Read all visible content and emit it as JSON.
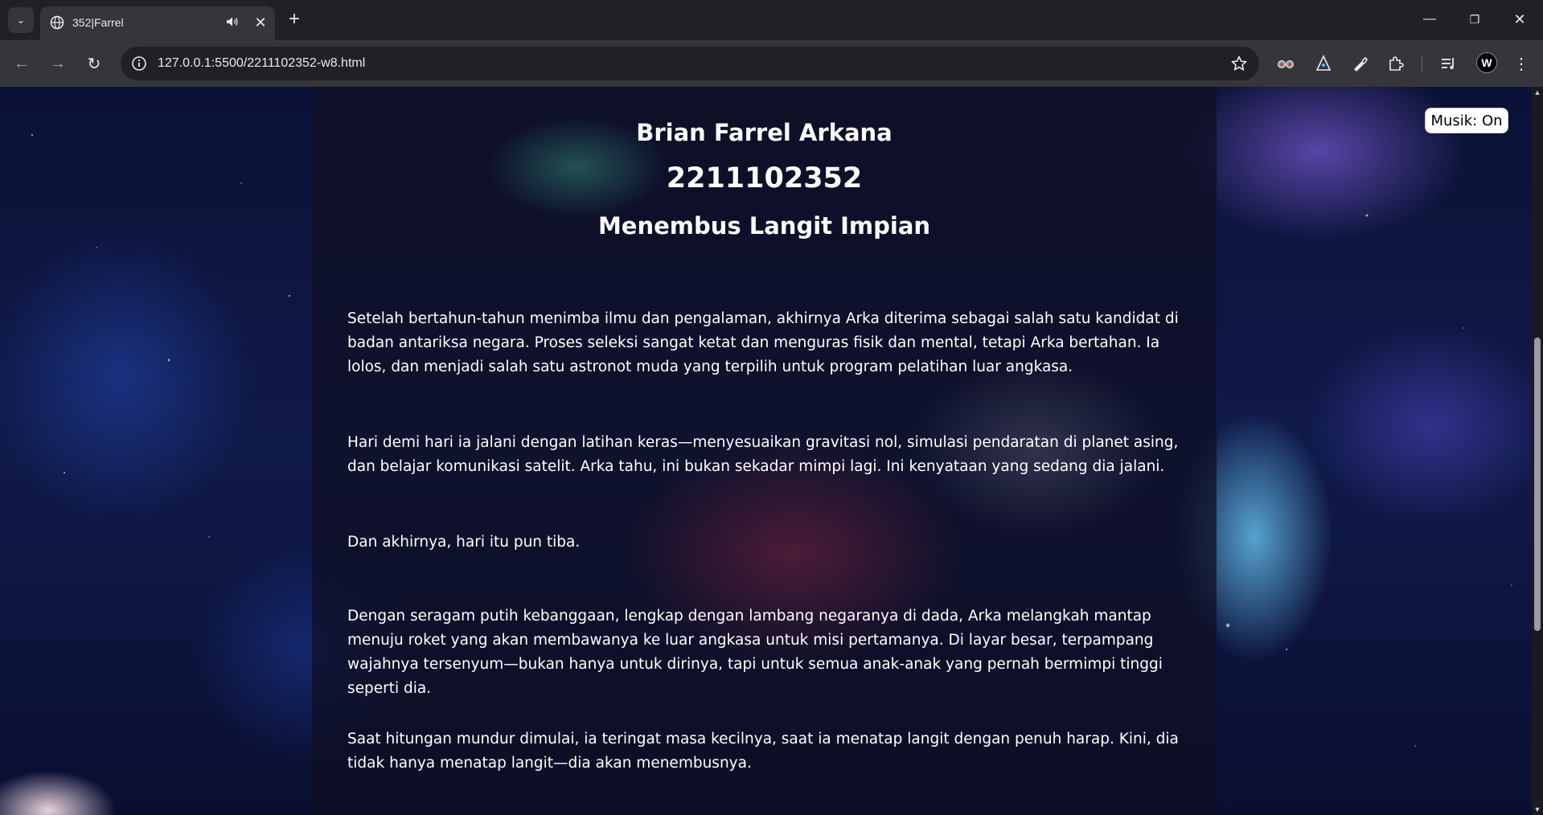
{
  "browser": {
    "tab": {
      "title": "352|Farrel",
      "close_glyph": "✕",
      "favicon_icon": "globe-icon",
      "audio_icon": "speaker-icon"
    },
    "new_tab_glyph": "+",
    "tab_search_glyph": "⌄",
    "window_controls": {
      "minimize": "—",
      "restore": "❐",
      "close": "✕"
    },
    "nav": {
      "back": "←",
      "forward": "→",
      "reload": "↻"
    },
    "url": "127.0.0.1:5500/2211102352-w8.html",
    "menu_glyph": "⋮",
    "profile_letter": "W"
  },
  "page": {
    "author_name": "Brian Farrel Arkana",
    "student_id": "2211102352",
    "story_title": "Menembus Langit Impian",
    "paragraphs": [
      "Setelah bertahun-tahun menimba ilmu dan pengalaman, akhirnya Arka diterima sebagai salah satu kandidat di badan antariksa negara. Proses seleksi sangat ketat dan menguras fisik dan mental, tetapi Arka bertahan. Ia lolos, dan menjadi salah satu astronot muda yang terpilih untuk program pelatihan luar angkasa.",
      "Hari demi hari ia jalani dengan latihan keras—menyesuaikan gravitasi nol, simulasi pendaratan di planet asing, dan belajar komunikasi satelit. Arka tahu, ini bukan sekadar mimpi lagi. Ini kenyataan yang sedang dia jalani.",
      "Dan akhirnya, hari itu pun tiba.",
      "Dengan seragam putih kebanggaan, lengkap dengan lambang negaranya di dada, Arka melangkah mantap menuju roket yang akan membawanya ke luar angkasa untuk misi pertamanya. Di layar besar, terpampang wajahnya tersenyum—bukan hanya untuk dirinya, tapi untuk semua anak-anak yang pernah bermimpi tinggi seperti dia.",
      "Saat hitungan mundur dimulai, ia teringat masa kecilnya, saat ia menatap langit dengan penuh harap. Kini, dia tidak hanya menatap langit—dia akan menembusnya."
    ],
    "music_button": "Musik: On"
  }
}
